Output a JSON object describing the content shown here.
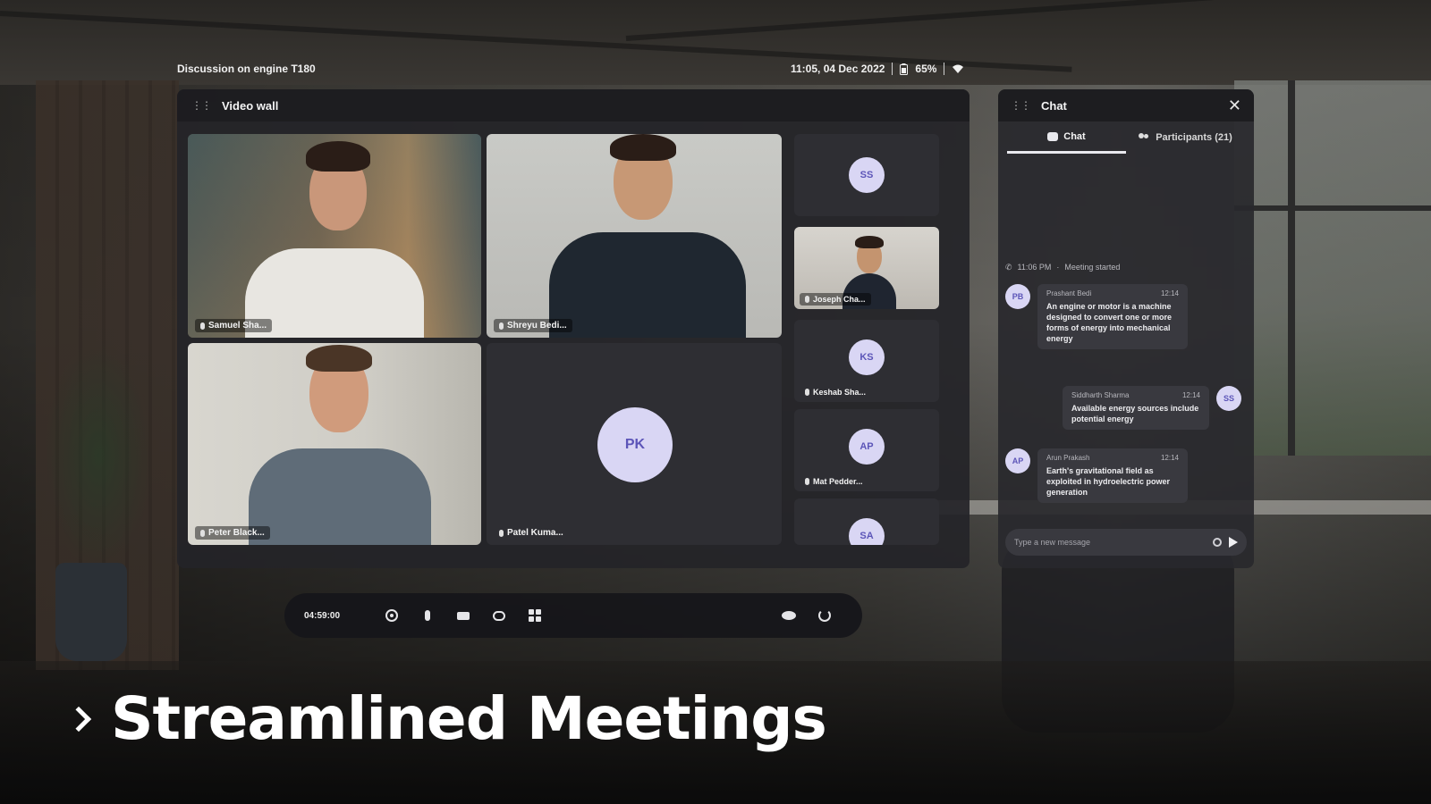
{
  "status_bar": {
    "session_title": "Discussion on engine T180",
    "datetime": "11:05, 04 Dec 2022",
    "battery": "65%",
    "battery_icon": "battery-icon",
    "wifi_icon": "wifi-icon"
  },
  "video_wall": {
    "title": "Video wall",
    "tiles": [
      {
        "name": "Samuel Sha...",
        "type": "video"
      },
      {
        "name": "Shreyu Bedi...",
        "type": "video"
      },
      {
        "name": "Peter Black...",
        "type": "video"
      },
      {
        "name": "Patel Kuma...",
        "initials": "PK",
        "type": "avatar"
      }
    ],
    "side_tiles": [
      {
        "initials": "SS",
        "name": ""
      },
      {
        "name": "Joseph Cha...",
        "type": "video"
      },
      {
        "initials": "KS",
        "name": "Keshab Sha..."
      },
      {
        "initials": "AP",
        "name": "Mat Pedder..."
      },
      {
        "initials": "SA",
        "name": ""
      }
    ]
  },
  "chat": {
    "title": "Chat",
    "tabs": [
      {
        "label": "Chat",
        "active": true
      },
      {
        "label": "Participants (21)",
        "active": false
      }
    ],
    "system_message": {
      "time": "11:06 PM",
      "text": "Meeting started"
    },
    "messages": [
      {
        "initials": "PB",
        "author": "Prashant Bedi",
        "time": "12:14",
        "text": "An engine or motor is a machine designed to convert one or more forms of energy into mechanical energy"
      },
      {
        "initials": "SS",
        "author": "Siddharth Sharma",
        "time": "12:14",
        "text": "Available energy sources include potential energy"
      },
      {
        "initials": "AP",
        "author": "Arun Prakash",
        "time": "12:14",
        "text": "Earth's gravitational field as exploited in hydroelectric power generation"
      }
    ],
    "input_placeholder": "Type a new message"
  },
  "toolbar": {
    "timer": "04:59:00"
  },
  "headline": "Streamlined Meetings",
  "colors": {
    "avatar_bg": "#d9d6f4",
    "avatar_fg": "#5c55b8",
    "panel_bg": "#242428"
  }
}
